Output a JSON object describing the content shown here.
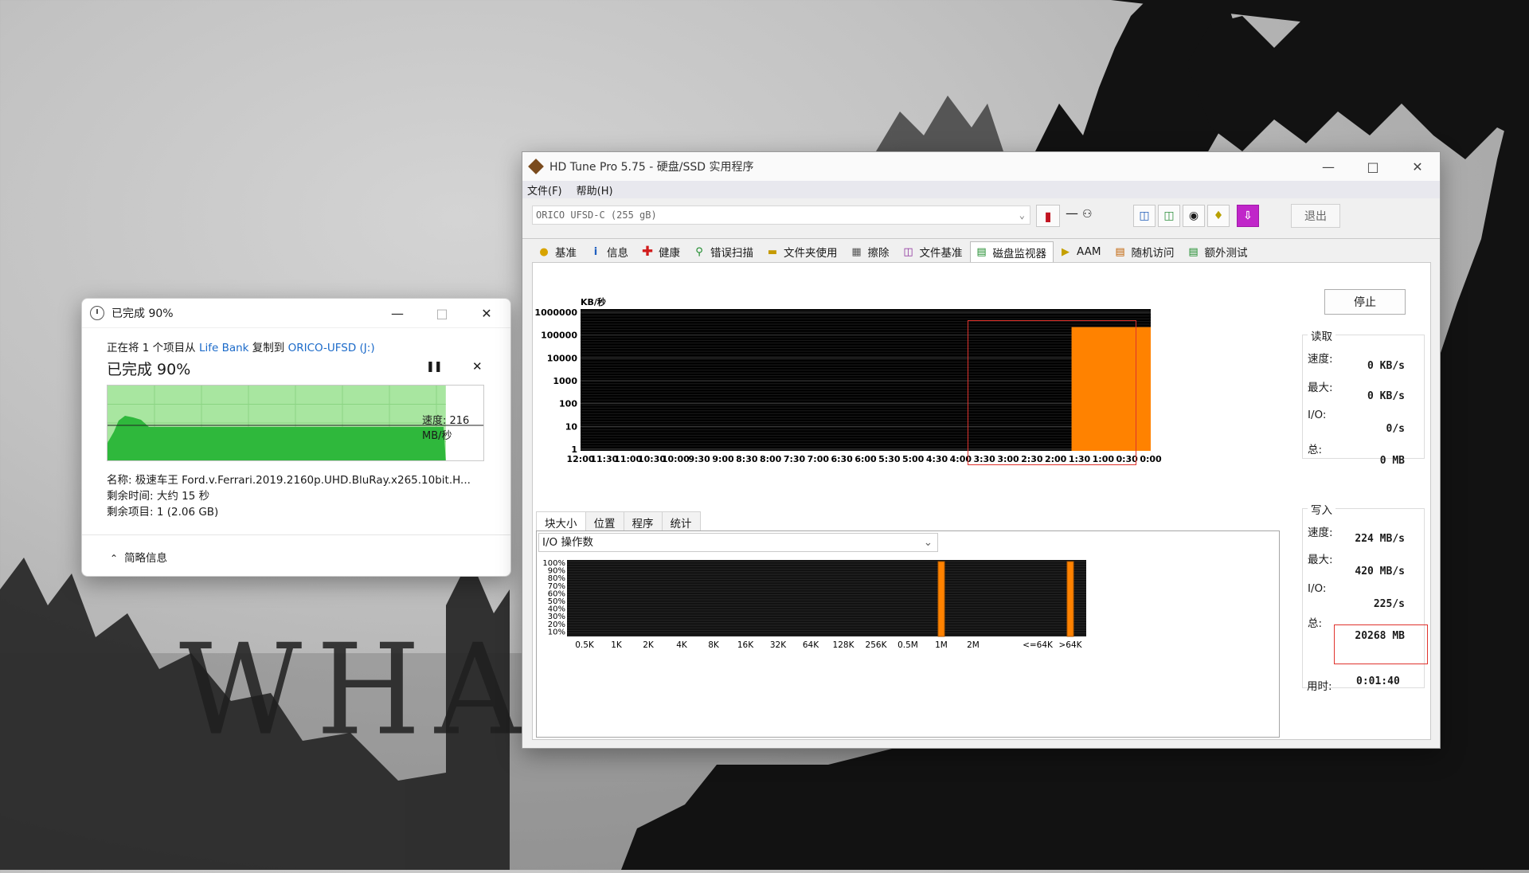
{
  "colors": {
    "graph_green_fill": "#2fb83c",
    "graph_green_bg": "#a8e6a0",
    "orange": "#ff8200",
    "highlight_red": "#e0332d",
    "link_blue": "#1b6ac9"
  },
  "background": {
    "text": "WHAT?"
  },
  "copy_dialog": {
    "title": "已完成 90%",
    "line1_prefix": "正在将 1 个项目从 ",
    "source": "Life Bank",
    "line1_mid": " 复制到 ",
    "destination": "ORICO-UFSD (J:)",
    "progress_text": "已完成 90%",
    "progress_value": 0.9,
    "speed_text": "速度: 216 MB/秒",
    "name_line": "名称: 极速车王 Ford.v.Ferrari.2019.2160p.UHD.BluRay.x265.10bit.H...",
    "time_left": "剩余时间: 大约 15 秒",
    "items_left": "剩余项目: 1 (2.06 GB)",
    "details_label": "简略信息",
    "icons": {
      "clock": "clock-icon",
      "pause": "pause-icon",
      "cancel": "close-icon",
      "chevron": "chevron-up-icon"
    }
  },
  "hdtune": {
    "title": "HD Tune Pro 5.75 - 硬盘/SSD 实用程序",
    "menu": [
      "文件(F)",
      "帮助(H)"
    ],
    "drive": "ORICO   UFSD-C (255 gB)",
    "dash": "—",
    "exit_label": "退出",
    "tabs": [
      {
        "label": "基准",
        "icon": "bulb-icon"
      },
      {
        "label": "信息",
        "icon": "info-icon"
      },
      {
        "label": "健康",
        "icon": "health-cross-icon"
      },
      {
        "label": "错误扫描",
        "icon": "magnifier-icon"
      },
      {
        "label": "文件夹使用",
        "icon": "folder-icon"
      },
      {
        "label": "擦除",
        "icon": "trash-icon"
      },
      {
        "label": "文件基准",
        "icon": "file-benchmark-icon"
      },
      {
        "label": "磁盘监视器",
        "icon": "disk-monitor-icon"
      },
      {
        "label": "AAM",
        "icon": "speaker-icon"
      },
      {
        "label": "随机访问",
        "icon": "random-access-icon"
      },
      {
        "label": "额外测试",
        "icon": "extra-tests-icon"
      }
    ],
    "active_tab": "磁盘监视器",
    "stop_label": "停止",
    "read": {
      "title": "读取",
      "speed_label": "速度:",
      "speed": "0 KB/s",
      "max_label": "最大:",
      "max": "0 KB/s",
      "io_label": "I/O:",
      "io": "0/s",
      "total_label": "总:",
      "total": "0 MB"
    },
    "write": {
      "title": "写入",
      "speed_label": "速度:",
      "speed": "224 MB/s",
      "max_label": "最大:",
      "max": "420 MB/s",
      "io_label": "I/O:",
      "io": "225/s",
      "total_label": "总:",
      "total": "20268 MB"
    },
    "elapsed_label": "用时:",
    "elapsed": "0:01:40",
    "subtabs": [
      "块大小",
      "位置",
      "程序",
      "统计"
    ],
    "io_select": "I/O  操作数"
  },
  "chart_data": [
    {
      "type": "area",
      "title": "",
      "ylabel": "KB/秒",
      "yscale": "log",
      "ylim": [
        1,
        1000000
      ],
      "y_ticks": [
        "1000000",
        "100000",
        "10000",
        "1000",
        "100",
        "10",
        "1"
      ],
      "x_ticks": [
        "12:00",
        "11:30",
        "11:00",
        "10:30",
        "10:00",
        "9:30",
        "9:00",
        "8:30",
        "8:00",
        "7:30",
        "7:00",
        "6:30",
        "6:00",
        "5:30",
        "5:00",
        "4:30",
        "4:00",
        "3:30",
        "3:00",
        "2:30",
        "2:00",
        "1:30",
        "1:00",
        "0:30",
        "0:00"
      ],
      "series": [
        {
          "x_start": "1:40",
          "x_end": "0:00",
          "value": 224000
        }
      ]
    },
    {
      "type": "bar",
      "categories": [
        "0.5K",
        "1K",
        "2K",
        "4K",
        "8K",
        "16K",
        "32K",
        "64K",
        "128K",
        "256K",
        "0.5M",
        "1M",
        "2M",
        "<=64K",
        ">64K"
      ],
      "y_ticks": [
        "100%",
        "90%",
        "80%",
        "70%",
        "60%",
        "50%",
        "40%",
        "30%",
        "20%",
        "10%"
      ],
      "values": [
        0,
        0,
        0,
        0,
        0,
        0,
        0,
        0,
        0,
        0,
        0,
        100,
        0,
        0,
        100
      ]
    }
  ]
}
